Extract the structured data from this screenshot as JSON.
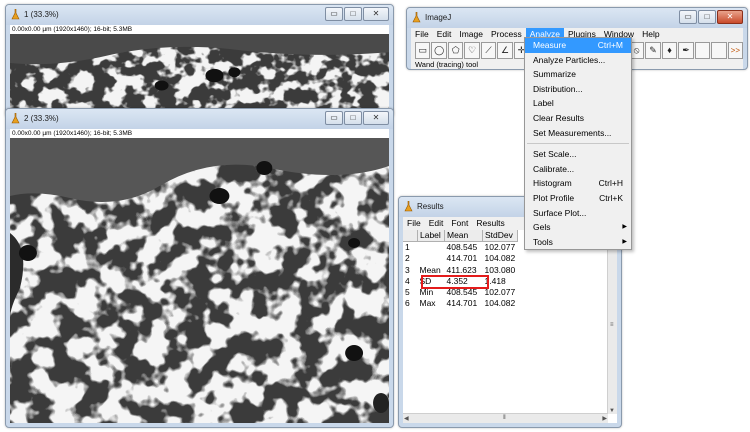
{
  "image1": {
    "title": "1 (33.3%)",
    "info": "0.00x0.00 µm (1920x1460); 16-bit; 5.3MB"
  },
  "image2": {
    "title": "2 (33.3%)",
    "info": "0.00x0.00 µm (1920x1460); 16-bit; 5.3MB"
  },
  "imagej": {
    "title": "ImageJ",
    "menu": [
      "File",
      "Edit",
      "Image",
      "Process",
      "Analyze",
      "Plugins",
      "Window",
      "Help"
    ],
    "open_menu": "Analyze",
    "status": "Wand (tracing) tool",
    "more_tools": ">>"
  },
  "analyze_menu": {
    "items": [
      {
        "label": "Measure",
        "shortcut": "Ctrl+M"
      },
      {
        "label": "Analyze Particles..."
      },
      {
        "label": "Summarize"
      },
      {
        "label": "Distribution..."
      },
      {
        "label": "Label"
      },
      {
        "label": "Clear Results"
      },
      {
        "label": "Set Measurements..."
      },
      {
        "separator": true
      },
      {
        "label": "Set Scale..."
      },
      {
        "label": "Calibrate..."
      },
      {
        "label": "Histogram",
        "shortcut": "Ctrl+H"
      },
      {
        "label": "Plot Profile",
        "shortcut": "Ctrl+K"
      },
      {
        "label": "Surface Plot..."
      },
      {
        "label": "Gels",
        "submenu": true
      },
      {
        "label": "Tools",
        "submenu": true
      }
    ],
    "highlighted": "Measure"
  },
  "results": {
    "title": "Results",
    "menu": [
      "File",
      "Edit",
      "Font",
      "Results"
    ],
    "columns": [
      "",
      "Label",
      "Mean",
      "StdDev"
    ],
    "rows": [
      [
        "1",
        "",
        "408.545",
        "102.077"
      ],
      [
        "2",
        "",
        "414.701",
        "104.082"
      ],
      [
        "3",
        "Mean",
        "411.623",
        "103.080"
      ],
      [
        "4",
        "SD",
        "4.352",
        "1.418"
      ],
      [
        "5",
        "Min",
        "408.545",
        "102.077"
      ],
      [
        "6",
        "Max",
        "414.701",
        "104.082"
      ]
    ],
    "highlighted_row": "3"
  },
  "colors": {
    "menu_highlight": "#3399ff",
    "annotation_box": "#e41b1b",
    "window_frame": "#c9d8ea"
  }
}
